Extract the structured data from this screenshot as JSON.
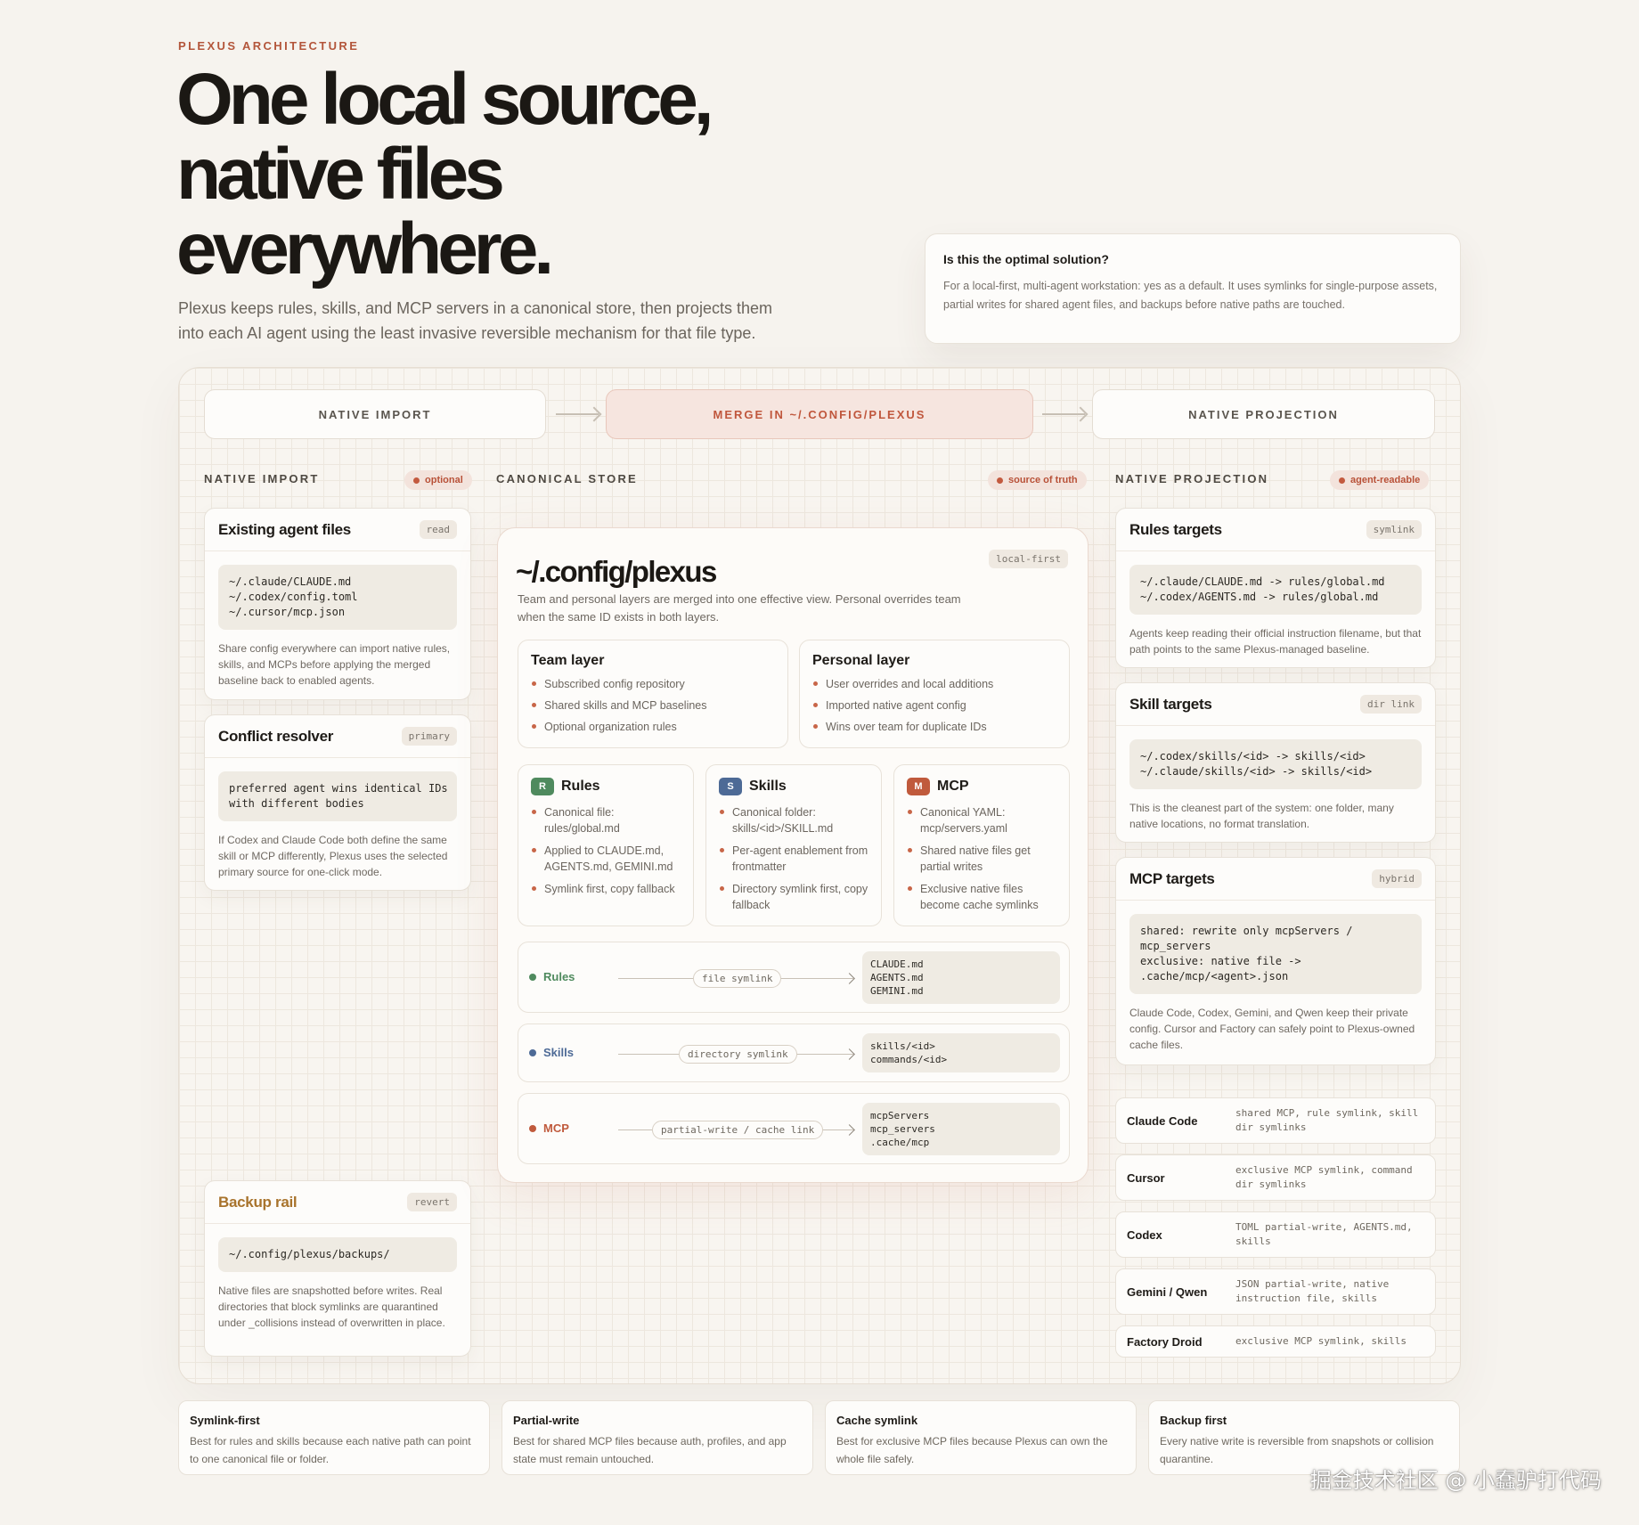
{
  "hero": {
    "eyebrow": "PLEXUS ARCHITECTURE",
    "title_line1": "One local source,",
    "title_line2": "native files",
    "title_line3": "everywhere.",
    "subtitle": "Plexus keeps rules, skills, and MCP servers in a canonical store, then projects them into each AI agent using the least invasive reversible mechanism for that file type."
  },
  "callout": {
    "title": "Is this the optimal solution?",
    "body": "For a local-first, multi-agent workstation: yes as a default. It uses symlinks for single-purpose assets, partial writes for shared agent files, and backups before native paths are touched."
  },
  "stages": [
    "NATIVE IMPORT",
    "MERGE IN ~/.CONFIG/PLEXUS",
    "NATIVE PROJECTION"
  ],
  "columns": {
    "import": {
      "label": "NATIVE IMPORT",
      "pill": "optional"
    },
    "store": {
      "label": "CANONICAL STORE",
      "pill": "source of truth"
    },
    "projection": {
      "label": "NATIVE PROJECTION",
      "pill": "agent-readable"
    }
  },
  "left_cards": {
    "existing": {
      "title": "Existing agent files",
      "tag": "read",
      "code": "~/.claude/CLAUDE.md\n~/.codex/config.toml\n~/.cursor/mcp.json",
      "note": "Share config everywhere can import native rules, skills, and MCPs before applying the merged baseline back to enabled agents."
    },
    "resolver": {
      "title": "Conflict resolver",
      "tag": "primary",
      "code": "preferred agent wins identical IDs\nwith different bodies",
      "note": "If Codex and Claude Code both define the same skill or MCP differently, Plexus uses the selected primary source for one-click mode."
    },
    "backup": {
      "title": "Backup rail",
      "tag": "revert",
      "code": "~/.config/plexus/backups/",
      "note": "Native files are snapshotted before writes. Real directories that block symlinks are quarantined under _collisions instead of overwritten in place."
    }
  },
  "store": {
    "title": "~/.config/plexus",
    "tag": "local-first",
    "subtitle": "Team and personal layers are merged into one effective view. Personal overrides team when the same ID exists in both layers.",
    "team": {
      "title": "Team layer",
      "items": [
        "Subscribed config repository",
        "Shared skills and MCP baselines",
        "Optional organization rules"
      ]
    },
    "personal": {
      "title": "Personal layer",
      "items": [
        "User overrides and local additions",
        "Imported native agent config",
        "Wins over team for duplicate IDs"
      ]
    },
    "assets": [
      {
        "badge": "R",
        "label": "Rules",
        "color": "#4f8a5e",
        "items": [
          "Canonical file: rules/global.md",
          "Applied to CLAUDE.md, AGENTS.md, GEMINI.md",
          "Symlink first, copy fallback"
        ]
      },
      {
        "badge": "S",
        "label": "Skills",
        "color": "#4d6a96",
        "items": [
          "Canonical folder: skills/<id>/SKILL.md",
          "Per-agent enablement from frontmatter",
          "Directory symlink first, copy fallback"
        ]
      },
      {
        "badge": "M",
        "label": "MCP",
        "color": "#c05a3c",
        "items": [
          "Canonical YAML: mcp/servers.yaml",
          "Shared native files get partial writes",
          "Exclusive native files become cache symlinks"
        ]
      }
    ],
    "flows": [
      {
        "label": "Rules",
        "color": "#4f8a5e",
        "method": "file symlink",
        "targets": "CLAUDE.md\nAGENTS.md\nGEMINI.md"
      },
      {
        "label": "Skills",
        "color": "#4d6a96",
        "method": "directory symlink",
        "targets": "skills/<id>\ncommands/<id>"
      },
      {
        "label": "MCP",
        "color": "#c05a3c",
        "method": "partial-write / cache link",
        "targets": "mcpServers\nmcp_servers\n.cache/mcp"
      }
    ]
  },
  "right_cards": {
    "rules": {
      "title": "Rules targets",
      "tag": "symlink",
      "code": "~/.claude/CLAUDE.md -> rules/global.md\n~/.codex/AGENTS.md -> rules/global.md",
      "note": "Agents keep reading their official instruction filename, but that path points to the same Plexus-managed baseline."
    },
    "skills": {
      "title": "Skill targets",
      "tag": "dir link",
      "code": "~/.codex/skills/<id> -> skills/<id>\n~/.claude/skills/<id> -> skills/<id>",
      "note": "This is the cleanest part of the system: one folder, many native locations, no format translation."
    },
    "mcp": {
      "title": "MCP targets",
      "tag": "hybrid",
      "code": "shared: rewrite only mcpServers /\nmcp_servers\nexclusive: native file ->\n.cache/mcp/<agent>.json",
      "note": "Claude Code, Codex, Gemini, and Qwen keep their private config. Cursor and Factory can safely point to Plexus-owned cache files."
    }
  },
  "agents": [
    {
      "name": "Claude Code",
      "desc": "shared MCP, rule symlink, skill dir symlinks"
    },
    {
      "name": "Cursor",
      "desc": "exclusive MCP symlink, command dir symlinks"
    },
    {
      "name": "Codex",
      "desc": "TOML partial-write, AGENTS.md, skills"
    },
    {
      "name": "Gemini / Qwen",
      "desc": "JSON partial-write, native instruction file, skills"
    },
    {
      "name": "Factory Droid",
      "desc": "exclusive MCP symlink, skills"
    }
  ],
  "strategies": [
    {
      "title": "Symlink-first",
      "body": "Best for rules and skills because each native path can point to one canonical file or folder."
    },
    {
      "title": "Partial-write",
      "body": "Best for shared MCP files because auth, profiles, and app state must remain untouched."
    },
    {
      "title": "Cache symlink",
      "body": "Best for exclusive MCP files because Plexus can own the whole file safely."
    },
    {
      "title": "Backup first",
      "body": "Every native write is reversible from snapshots or collision quarantine."
    }
  ],
  "watermark": "掘金技术社区 @ 小蠢驴打代码"
}
